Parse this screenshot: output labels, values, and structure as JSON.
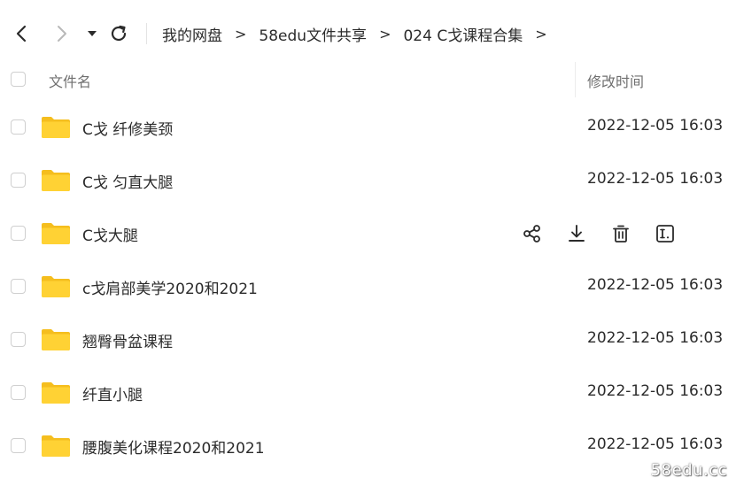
{
  "nav": {
    "back_icon": "chevron-left-icon",
    "forward_icon": "chevron-right-icon",
    "dropdown_icon": "caret-down-icon",
    "refresh_icon": "refresh-icon"
  },
  "breadcrumb": {
    "items": [
      "我的网盘",
      "58edu文件共享",
      "024 C戈课程合集"
    ],
    "separator": ">"
  },
  "table": {
    "headers": {
      "name": "文件名",
      "modified": "修改时间"
    },
    "rows": [
      {
        "name": "C戈 纤修美颈",
        "modified": "2022-12-05 16:03",
        "hovered": false
      },
      {
        "name": "C戈 匀直大腿",
        "modified": "2022-12-05 16:03",
        "hovered": false
      },
      {
        "name": "C戈大腿",
        "modified": "",
        "hovered": true
      },
      {
        "name": "c戈肩部美学2020和2021",
        "modified": "2022-12-05 16:03",
        "hovered": false
      },
      {
        "name": "翘臀骨盆课程",
        "modified": "2022-12-05 16:03",
        "hovered": false
      },
      {
        "name": "纤直小腿",
        "modified": "2022-12-05 16:03",
        "hovered": false
      },
      {
        "name": "腰腹美化课程2020和2021",
        "modified": "2022-12-05 16:03",
        "hovered": false
      }
    ],
    "hover_actions": [
      "share-icon",
      "download-icon",
      "delete-icon",
      "rename-icon"
    ]
  },
  "colors": {
    "folder": "#FFD234",
    "folder_back": "#F5BE1E",
    "text": "#2b2b2b",
    "header_text": "#6f6f6f"
  },
  "watermark": "58edu.cc"
}
